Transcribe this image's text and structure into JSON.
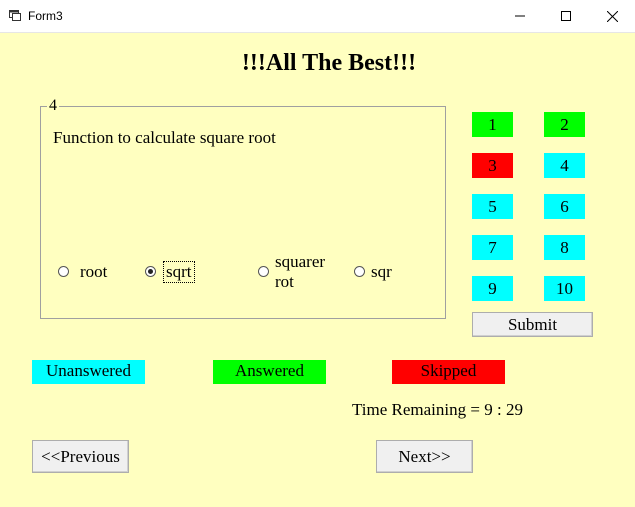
{
  "window": {
    "title": "Form3"
  },
  "heading": "!!!All The Best!!!",
  "question_group": {
    "number": "4",
    "text": "Function to calculate square root",
    "options": [
      {
        "label": "root",
        "checked": false
      },
      {
        "label": "sqrt",
        "checked": true
      },
      {
        "label": "squarer rot",
        "line1": "squarer",
        "line2": "rot",
        "checked": false
      },
      {
        "label": "sqr",
        "checked": false
      }
    ]
  },
  "question_buttons": [
    {
      "label": "1",
      "status": "answered",
      "color": "#00ff00"
    },
    {
      "label": "2",
      "status": "answered",
      "color": "#00ff00"
    },
    {
      "label": "3",
      "status": "skipped",
      "color": "#ff0000"
    },
    {
      "label": "4",
      "status": "unanswered",
      "color": "#00ffff"
    },
    {
      "label": "5",
      "status": "unanswered",
      "color": "#00ffff"
    },
    {
      "label": "6",
      "status": "unanswered",
      "color": "#00ffff"
    },
    {
      "label": "7",
      "status": "unanswered",
      "color": "#00ffff"
    },
    {
      "label": "8",
      "status": "unanswered",
      "color": "#00ffff"
    },
    {
      "label": "9",
      "status": "unanswered",
      "color": "#00ffff"
    },
    {
      "label": "10",
      "status": "unanswered",
      "color": "#00ffff"
    }
  ],
  "submit_label": "Submit",
  "legend": {
    "unanswered": {
      "label": "Unanswered",
      "color": "#00ffff"
    },
    "answered": {
      "label": "Answered",
      "color": "#00ff00"
    },
    "skipped": {
      "label": "Skipped",
      "color": "#ff0000"
    }
  },
  "timer": "Time Remaining = 9 : 29",
  "nav": {
    "previous_label": "<<Previous",
    "next_label": "Next>>"
  },
  "colors": {
    "background": "#ffffc0"
  }
}
